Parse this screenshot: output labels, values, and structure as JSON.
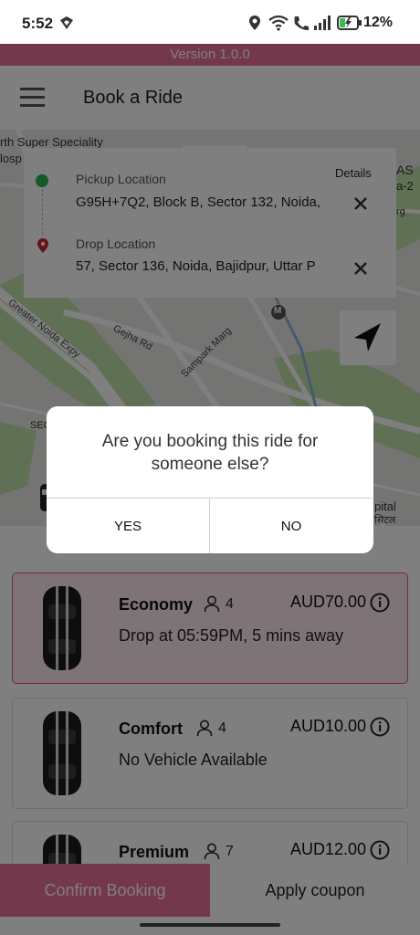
{
  "status_bar": {
    "time": "5:52",
    "battery_percent": "12%",
    "icons": [
      "location-icon",
      "wifi-icon",
      "wifi-calling-icon",
      "signal-icon",
      "battery-charging-icon"
    ]
  },
  "version_label": "Version 1.0.0",
  "app_bar": {
    "title": "Book a Ride",
    "menu_icon": "hamburger-menu-icon"
  },
  "map": {
    "labels": [
      "rth Super Speciality",
      "losp",
      "Gejha Rd",
      "Sampark Marg",
      "Greater Noida Expy",
      "M",
      "AS",
      "a-2",
      "rg",
      "SEC",
      "pital",
      "सिटल"
    ]
  },
  "location_card": {
    "details_label": "Details",
    "pickup": {
      "label": "Pickup Location",
      "value": "G95H+7Q2, Block B, Sector 132, Noida,"
    },
    "drop": {
      "label": "Drop Location",
      "value": "57, Sector 136, Noida, Bajidpur, Uttar P"
    }
  },
  "vehicles": [
    {
      "name": "Economy",
      "seats": "4",
      "price": "AUD70.00",
      "info": "Drop at 05:59PM, 5 mins away",
      "selected": true
    },
    {
      "name": "Comfort",
      "seats": "4",
      "price": "AUD10.00",
      "info": "No Vehicle Available",
      "selected": false
    },
    {
      "name": "Premium",
      "seats": "7",
      "price": "AUD12.00",
      "info": "",
      "selected": false
    }
  ],
  "bottom": {
    "confirm_label": "Confirm Booking",
    "coupon_label": "Apply coupon"
  },
  "dialog": {
    "message": "Are you booking this ride for someone else?",
    "yes_label": "YES",
    "no_label": "NO"
  },
  "colors": {
    "brand_pink": "#e8709a",
    "selected_border": "#e0558a",
    "pickup_dot": "#2bb24c",
    "drop_pin": "#c62828"
  }
}
